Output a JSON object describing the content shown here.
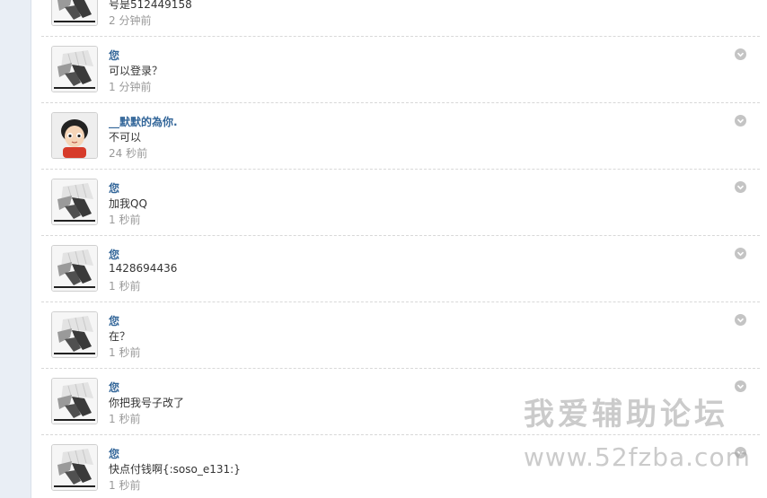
{
  "colors": {
    "author": "#336699",
    "text": "#333333",
    "time": "#999999",
    "divider": "#d8d8d8",
    "left_rail": "#e9eef5",
    "menu_toggle": "#c4c4c4",
    "watermark": "#a0a0a0"
  },
  "messages": [
    {
      "author": "",
      "text": "号是512449158",
      "time": "2 分钟前",
      "avatar": "anime-avatar"
    },
    {
      "author": "您",
      "text": "可以登录？",
      "time": "1 分钟前",
      "avatar": "anime-avatar"
    },
    {
      "author": "__默默的為你.",
      "text": "不可以",
      "time": "24 秒前",
      "avatar": "cartoon-child-avatar"
    },
    {
      "author": "您",
      "text": "加我QQ",
      "time": "1 秒前",
      "avatar": "anime-avatar"
    },
    {
      "author": "您",
      "text": "1428694436",
      "time": "1 秒前",
      "avatar": "anime-avatar"
    },
    {
      "author": "您",
      "text": "在？",
      "time": "1 秒前",
      "avatar": "anime-avatar"
    },
    {
      "author": "您",
      "text": "你把我号子改了",
      "time": "1 秒前",
      "avatar": "anime-avatar"
    },
    {
      "author": "您",
      "text": "快点付钱啊{:soso_e131:}",
      "time": "1 秒前",
      "avatar": "anime-avatar"
    }
  ],
  "watermark": {
    "title": "我爱辅助论坛",
    "url": "www.52fzba.com"
  },
  "icons": {
    "menu_toggle": "chevron-down-icon"
  }
}
